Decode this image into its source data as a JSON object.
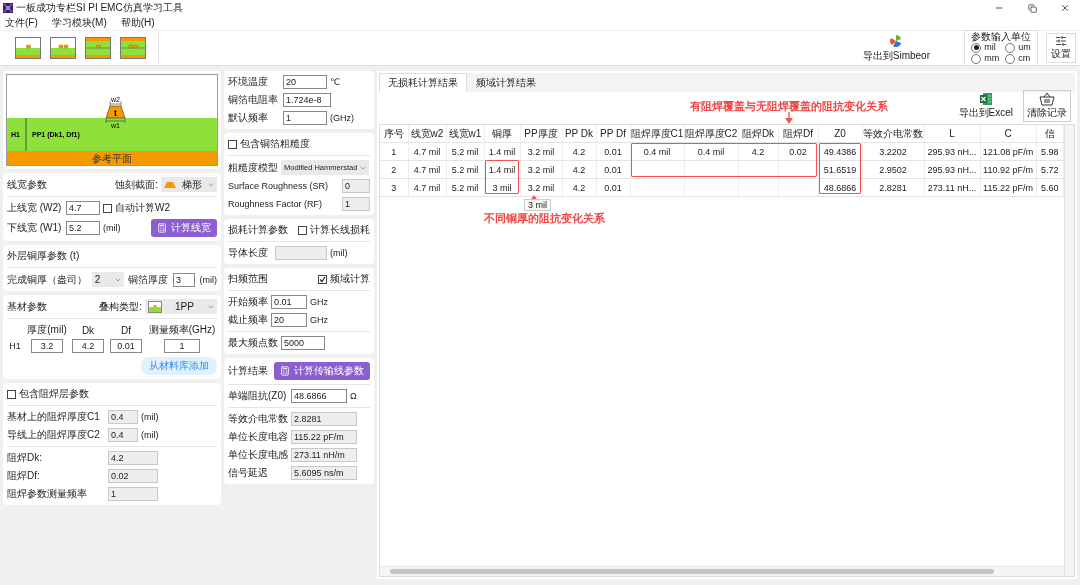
{
  "window": {
    "title": "一板成功专栏SI PI EMC仿真学习工具"
  },
  "menu": [
    "文件(F)",
    "学习模块(M)",
    "帮助(H)"
  ],
  "toolbar": {
    "export_simbeor": "导出到Simbeor",
    "units": {
      "title": "参数输入单位",
      "options": [
        {
          "label": "mil",
          "selected": true
        },
        {
          "label": "um",
          "selected": false
        },
        {
          "label": "mm",
          "selected": false
        },
        {
          "label": "cm",
          "selected": false
        }
      ]
    },
    "settings": "设置"
  },
  "diagram": {
    "w2": "w2",
    "t": "t",
    "w1": "w1",
    "h1": "H1",
    "layer": "PP1 (Dk1, Df1)",
    "reference": "参考平面"
  },
  "trace_params": {
    "title": "线宽参数",
    "etch_label": "蚀刻截面:",
    "etch_value": "梯形",
    "w2_label": "上线宽 (W2)",
    "w2": "4.7",
    "auto_w2": {
      "label": "自动计算W2",
      "checked": false
    },
    "w1_label": "下线宽 (W1)",
    "w1": "5.2",
    "unit": "(mil)",
    "button": "计算线宽"
  },
  "copper": {
    "title": "外层铜厚参数 (t)",
    "finish_label": "完成铜厚（盎司）",
    "finish_value": "2",
    "foil_label": "铜箔厚度",
    "foil_value": "3",
    "unit": "(mil)"
  },
  "substrate": {
    "title": "基材参数",
    "stack_label": "叠构类型:",
    "stack_value": "1PP",
    "columns": [
      "厚度(mil)",
      "Dk",
      "Df",
      "测量频率(GHz)"
    ],
    "rows": [
      {
        "name": "H1",
        "values": [
          "3.2",
          "4.2",
          "0.01",
          "1"
        ]
      }
    ],
    "button": "从材料库添加"
  },
  "solder_mask": {
    "include": {
      "label": "包含阻焊层参数",
      "checked": false
    },
    "thickness_fields": [
      {
        "label": "基材上的阻焊厚度C1",
        "value": "0.4",
        "unit": "(mil)"
      },
      {
        "label": "导线上的阻焊厚度C2",
        "value": "0.4",
        "unit": "(mil)"
      }
    ],
    "property_fields": [
      {
        "label": "阻焊Dk:",
        "value": "4.2"
      },
      {
        "label": "阻焊Df:",
        "value": "0.02"
      },
      {
        "label": "阻焊参数测量频率",
        "value": "1"
      }
    ]
  },
  "environment": {
    "fields": [
      {
        "label": "环境温度",
        "value": "20",
        "unit": "℃"
      },
      {
        "label": "铜箔电阻率",
        "value": "1.724e-8"
      },
      {
        "label": "默认频率",
        "value": "1",
        "unit": "(GHz)"
      }
    ]
  },
  "roughness": {
    "include": {
      "label": "包含铜箔粗糙度",
      "checked": false
    },
    "model_label": "粗糙度模型",
    "model_value": "Modified Hammerstad",
    "fields": [
      {
        "label": "Surface Roughness (SR)",
        "value": "0"
      },
      {
        "label": "Roughness Factor (RF)",
        "value": "1"
      }
    ]
  },
  "loss": {
    "title": "损耗计算参数",
    "long_line": {
      "label": "计算长线损耗",
      "checked": false
    },
    "length_label": "导体长度",
    "unit": "(mil)"
  },
  "sweep": {
    "title": "扫频范围",
    "frequency_domain": {
      "label": "频域计算",
      "checked": true
    },
    "fields": [
      {
        "label": "开始频率",
        "value": "0.01",
        "unit": "GHz"
      },
      {
        "label": "截止频率",
        "value": "20",
        "unit": "GHz"
      },
      {
        "label": "最大频点数",
        "value": "5000"
      }
    ]
  },
  "results": {
    "title": "计算结果",
    "button": "计算传输线参数",
    "fields": [
      {
        "label": "单端阻抗(Z0)",
        "value": "48.6866",
        "unit": "Ω",
        "kind": "editable"
      },
      {
        "label": "等效介电常数",
        "value": "2.8281",
        "kind": "readonly"
      },
      {
        "label": "单位长度电容",
        "value": "115.22 pF/m",
        "kind": "readonly"
      },
      {
        "label": "单位长度电感",
        "value": "273.11 nH/m",
        "kind": "readonly"
      },
      {
        "label": "信号延迟",
        "value": "5.6095 ns/m",
        "kind": "readonly"
      }
    ]
  },
  "tabs": [
    {
      "label": "无损耗计算结果",
      "selected": true
    },
    {
      "label": "频域计算结果",
      "selected": false
    }
  ],
  "actions": [
    {
      "label": "导出到Excel",
      "kind": "excel"
    },
    {
      "label": "清除记录",
      "kind": "clear"
    }
  ],
  "table": {
    "columns": [
      "序号",
      "线宽w2",
      "线宽w1",
      "铜厚",
      "PP厚度",
      "PP Dk",
      "PP Df",
      "阻焊厚度C1",
      "阻焊厚度C2",
      "阻焊Dk",
      "阻焊Df",
      "Z0",
      "等效介电常数",
      "L",
      "C",
      "信"
    ],
    "rows": [
      [
        "1",
        "4.7 mil",
        "5.2 mil",
        "1.4 mil",
        "3.2 mil",
        "4.2",
        "0.01",
        "0.4 mil",
        "0.4 mil",
        "4.2",
        "0.02",
        "49.4386",
        "3.2202",
        "295.93 nH...",
        "121.08 pF/m",
        "5.98"
      ],
      [
        "2",
        "4.7 mil",
        "5.2 mil",
        "1.4 mil",
        "3.2 mil",
        "4.2",
        "0.01",
        null,
        null,
        null,
        null,
        "51.6519",
        "2.9502",
        "295.93 nH...",
        "110.92 pF/m",
        "5.72"
      ],
      [
        "3",
        "4.7 mil",
        "5.2 mil",
        "3 mil",
        "3.2 mil",
        "4.2",
        "0.01",
        null,
        null,
        null,
        null,
        "48.6866",
        "2.8281",
        "273.11 nH...",
        "115.22 pF/m",
        "5.60"
      ]
    ]
  },
  "tooltip": "3 mil",
  "annotations": [
    {
      "text": "有阻焊覆盖与无阻焊覆盖的阻抗变化关系"
    },
    {
      "text": "不同铜厚的阻抗变化关系"
    }
  ]
}
